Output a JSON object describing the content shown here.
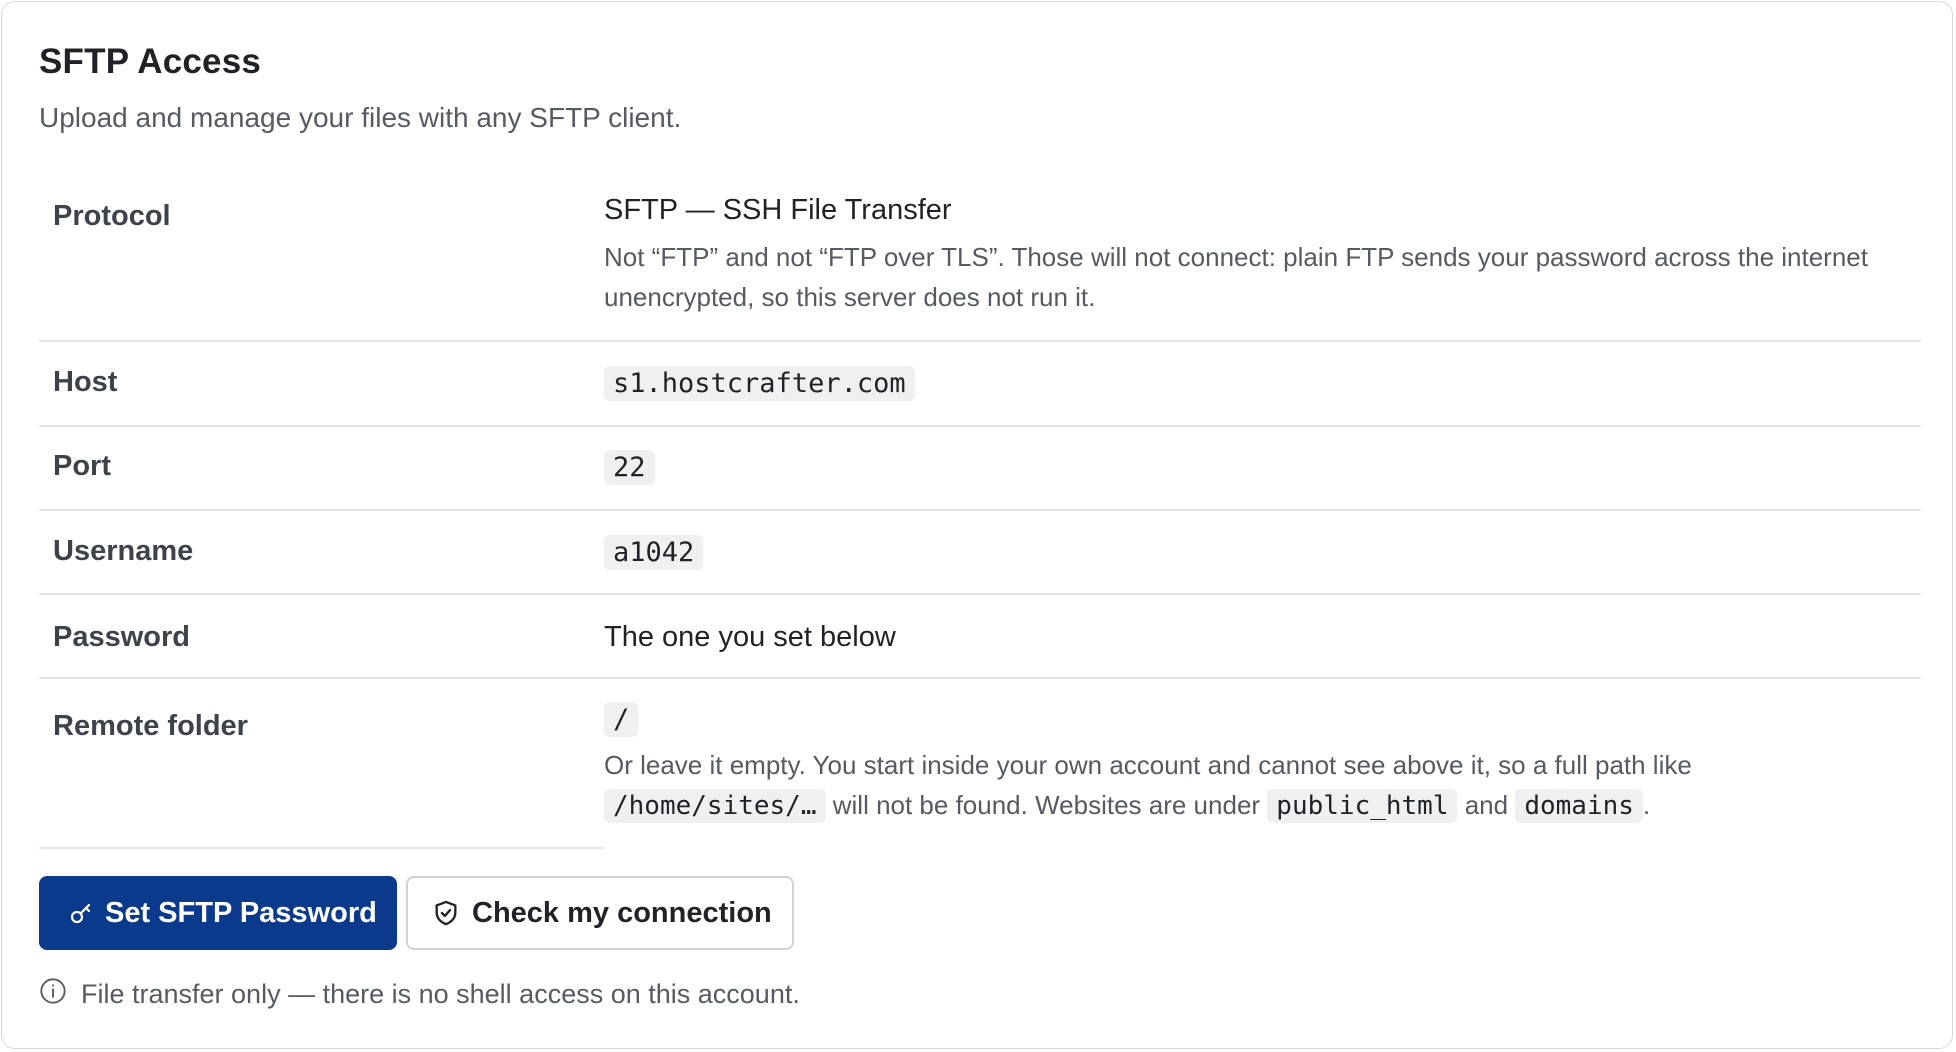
{
  "header": {
    "title": "SFTP Access",
    "subtitle": "Upload and manage your files with any SFTP client."
  },
  "details": {
    "protocol": {
      "label": "Protocol",
      "value": "SFTP — SSH File Transfer",
      "note": "Not “FTP” and not “FTP over TLS”. Those will not connect: plain FTP sends your password across the internet unencrypted, so this server does not run it."
    },
    "host": {
      "label": "Host",
      "value": "s1.hostcrafter.com"
    },
    "port": {
      "label": "Port",
      "value": "22"
    },
    "username": {
      "label": "Username",
      "value": "a1042"
    },
    "password": {
      "label": "Password",
      "value": "The one you set below"
    },
    "remote_folder": {
      "label": "Remote folder",
      "value": "/",
      "note_part1": "Or leave it empty. You start inside your own account and cannot see above it, so a full path like",
      "note_code1": "/home/sites/…",
      "note_part2": "will not be found. Websites are under",
      "note_code2": "public_html",
      "note_part3": "and",
      "note_code3": "domains",
      "note_part4": "."
    }
  },
  "actions": {
    "set_password_label": "Set SFTP Password",
    "set_password_icon": "key-icon",
    "check_connection_label": "Check my connection",
    "check_connection_icon": "shield-check-icon"
  },
  "footer": {
    "icon": "info-icon",
    "text": "File transfer only — there is no shell access on this account."
  },
  "colors": {
    "primary_button": "#0b3a8c",
    "code_background": "#eef0f2",
    "divider": "#e4e6ea"
  }
}
